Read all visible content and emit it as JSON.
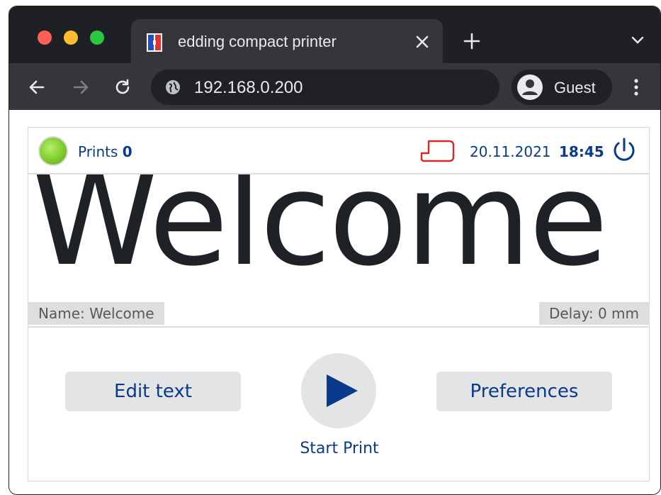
{
  "browser": {
    "tab_title": "edding compact printer",
    "url": "192.168.0.200",
    "profile_label": "Guest"
  },
  "status": {
    "prints_label": "Prints",
    "prints_count": "0",
    "date": "20.11.2021",
    "time": "18:45",
    "led_color": "#7ecb2c",
    "accent_color": "#0a3a8c",
    "media_icon_color": "#d62a2a"
  },
  "preview": {
    "text": "Welcome",
    "name_tag": "Name: Welcome",
    "delay_tag": "Delay: 0 mm"
  },
  "actions": {
    "edit_text_label": "Edit text",
    "start_print_label": "Start Print",
    "preferences_label": "Preferences"
  },
  "icons": {
    "back": "back-arrow-icon",
    "forward": "forward-arrow-icon",
    "reload": "reload-icon",
    "site": "globe-icon",
    "profile": "avatar-icon",
    "menu": "kebab-menu-icon",
    "media": "label-media-icon",
    "power": "power-icon",
    "play": "play-icon"
  }
}
